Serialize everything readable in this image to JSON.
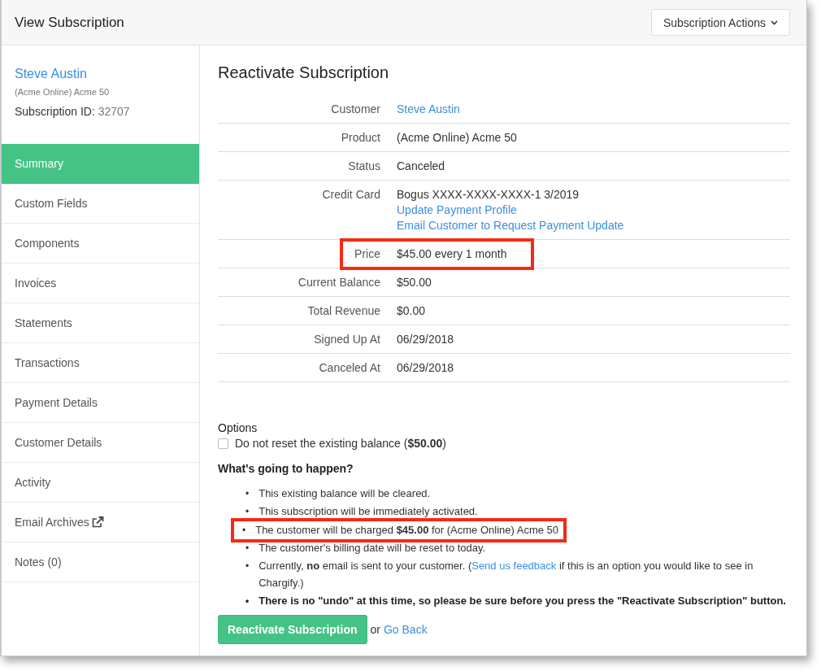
{
  "header": {
    "title": "View Subscription",
    "actions_button": "Subscription Actions"
  },
  "sidebar": {
    "customer_name": "Steve Austin",
    "product": "(Acme Online) Acme 50",
    "id_label": "Subscription ID:",
    "id_value": "32707",
    "items": [
      {
        "label": "Summary",
        "selected": true,
        "external": false
      },
      {
        "label": "Custom Fields",
        "selected": false,
        "external": false
      },
      {
        "label": "Components",
        "selected": false,
        "external": false
      },
      {
        "label": "Invoices",
        "selected": false,
        "external": false
      },
      {
        "label": "Statements",
        "selected": false,
        "external": false
      },
      {
        "label": "Transactions",
        "selected": false,
        "external": false
      },
      {
        "label": "Payment Details",
        "selected": false,
        "external": false
      },
      {
        "label": "Customer Details",
        "selected": false,
        "external": false
      },
      {
        "label": "Activity",
        "selected": false,
        "external": false
      },
      {
        "label": "Email Archives",
        "selected": false,
        "external": true
      },
      {
        "label": "Notes (0)",
        "selected": false,
        "external": false
      }
    ]
  },
  "main": {
    "title": "Reactivate Subscription",
    "details": [
      {
        "label": "Customer",
        "highlighted": false,
        "values": [
          {
            "kind": "link",
            "text": "Steve Austin"
          }
        ]
      },
      {
        "label": "Product",
        "highlighted": false,
        "values": [
          {
            "kind": "text",
            "text": "(Acme Online) Acme 50"
          }
        ]
      },
      {
        "label": "Status",
        "highlighted": false,
        "values": [
          {
            "kind": "text",
            "text": "Canceled"
          }
        ]
      },
      {
        "label": "Credit Card",
        "highlighted": false,
        "values": [
          {
            "kind": "text",
            "text": "Bogus XXXX-XXXX-XXXX-1 3/2019"
          },
          {
            "kind": "link",
            "text": "Update Payment Profile"
          },
          {
            "kind": "link",
            "text": "Email Customer to Request Payment Update"
          }
        ]
      },
      {
        "label": "Price",
        "highlighted": true,
        "values": [
          {
            "kind": "text",
            "text": "$45.00 every 1 month"
          }
        ]
      },
      {
        "label": "Current Balance",
        "highlighted": false,
        "values": [
          {
            "kind": "text",
            "text": "$50.00"
          }
        ]
      },
      {
        "label": "Total Revenue",
        "highlighted": false,
        "values": [
          {
            "kind": "text",
            "text": "$0.00"
          }
        ]
      },
      {
        "label": "Signed Up At",
        "highlighted": false,
        "values": [
          {
            "kind": "text",
            "text": "06/29/2018"
          }
        ]
      },
      {
        "label": "Canceled At",
        "highlighted": false,
        "values": [
          {
            "kind": "text",
            "text": "06/29/2018"
          }
        ]
      }
    ],
    "options_title": "Options",
    "option": {
      "label": "Do not reset the existing balance (**$50.00**)",
      "checked": false
    },
    "happen_title": "What's going to happen?",
    "bullets": [
      {
        "marker": "•",
        "text": "This existing balance will be cleared.",
        "bold": false,
        "highlighted": false
      },
      {
        "marker": "•",
        "text": "This subscription will be immediately activated.",
        "bold": false,
        "highlighted": false
      },
      {
        "marker": "•",
        "text": "The customer will be charged **$45.00** for (Acme Online) Acme 50",
        "bold": false,
        "highlighted": true
      },
      {
        "marker": "•",
        "text": "The customer's billing date will be reset to today.",
        "bold": false,
        "highlighted": false
      },
      {
        "marker": "•",
        "text": "Currently, **no** email is sent to your customer. (",
        "link": "Send us feedback",
        "after": " if this is an option you would like to see in Chargify.)",
        "bold": false,
        "highlighted": false
      },
      {
        "marker": "•",
        "text": "There is no \"undo\" at this time, so please be sure before you press the \"Reactivate Subscription\" button.",
        "bold": true,
        "highlighted": false
      }
    ],
    "submit_button": "Reactivate Subscription",
    "or_text": "or",
    "back_link": "Go Back"
  }
}
